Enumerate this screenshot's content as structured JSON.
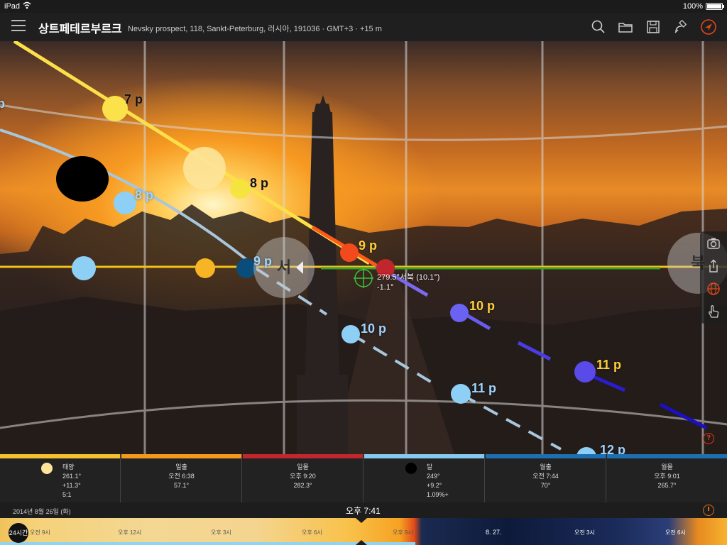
{
  "status_bar": {
    "carrier": "iPad",
    "battery": "100%"
  },
  "header": {
    "title": "상트페테르부르크",
    "location": "Nevsky prospect, 118, Sankt-Peterburg, 러시아, 191036 · GMT+3 · +15 m",
    "icons": [
      "menu-icon",
      "search-icon",
      "folder-icon",
      "save-icon",
      "satellite-icon",
      "location-arrow-icon"
    ]
  },
  "scene": {
    "sun_labels": {
      "p7": "7 p",
      "p8": "8 p",
      "p9": "9 p",
      "p10": "10 p",
      "p11": "11 p"
    },
    "moon_labels": {
      "p7": "p",
      "p8": "8 p",
      "p9": "9 p",
      "p10": "10 p",
      "p11": "11 p",
      "p12": "12 p"
    },
    "compass_west": "서",
    "compass_north": "북",
    "readout": {
      "azimuth": "279.5°서북 (10.1°)",
      "elevation": "-1.1°"
    },
    "help": "?",
    "side_icons": [
      "camera-icon",
      "share-icon",
      "globe-icon",
      "hand-icon"
    ]
  },
  "info": {
    "sun": {
      "title": "태양",
      "azimuth": "261.1°",
      "elevation": "+11.3°",
      "ratio": "5:1"
    },
    "sunrise": {
      "title": "일출",
      "time": "오전 6:38",
      "azimuth": "57.1°"
    },
    "sunset": {
      "title": "일몰",
      "time": "오후 9:20",
      "azimuth": "282.3°"
    },
    "moon": {
      "title": "달",
      "azimuth": "249°",
      "elevation": "+9.2°",
      "illum": "1.09%+"
    },
    "moonrise": {
      "title": "월출",
      "time": "오전 7:44",
      "azimuth": "70°"
    },
    "moonset": {
      "title": "월몰",
      "time": "오후 9:01",
      "azimuth": "265.7°"
    },
    "colors": {
      "sun": "#f6c12e",
      "sunrise": "#f39a1c",
      "sunset": "#c2272d",
      "moon": "#86c9ee",
      "moonrise": "#1e6fb0",
      "moonset": "#1e6fb0"
    }
  },
  "date_bar": {
    "date": "2014년 8월 26일 (화)",
    "time": "오후 7:41"
  },
  "timeline": {
    "zoom": "24시간",
    "ticks": [
      "오전 9시",
      "오후 12시",
      "오후 3시",
      "오후 6시",
      "오후 9시",
      "8. 27.",
      "오전 3시",
      "오전 6시"
    ]
  }
}
